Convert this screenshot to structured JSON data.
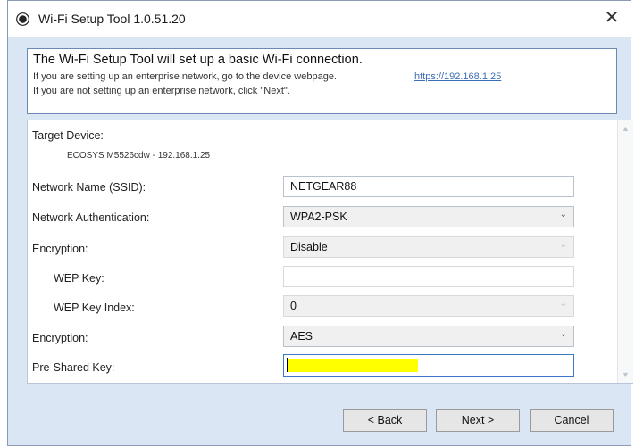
{
  "window": {
    "title": "Wi-Fi Setup Tool 1.0.51.20",
    "close_glyph": "✕"
  },
  "info": {
    "heading": "The Wi-Fi Setup Tool will set up a basic Wi-Fi connection.",
    "line1": "If you are setting up an enterprise network, go to the device webpage.",
    "link": "https://192.168.1.25",
    "line2": "If you are not setting up an enterprise network, click \"Next\"."
  },
  "form": {
    "target_device_label": "Target Device:",
    "target_device_value": "ECOSYS M5526cdw - 192.168.1.25",
    "ssid_label": "Network Name (SSID):",
    "ssid_value": "NETGEAR88",
    "auth_label": "Network Authentication:",
    "auth_value": "WPA2-PSK",
    "encryption1_label": "Encryption:",
    "encryption1_value": "Disable",
    "wep_key_label": "WEP Key:",
    "wep_key_value": "",
    "wep_index_label": "WEP Key Index:",
    "wep_index_value": "0",
    "encryption2_label": "Encryption:",
    "encryption2_value": "AES",
    "psk_label": "Pre-Shared Key:",
    "psk_value": ""
  },
  "buttons": {
    "back": "< Back",
    "next": "Next >",
    "cancel": "Cancel"
  },
  "icons": {
    "app": "app-logo-icon",
    "dropdown": "chevron-down-icon",
    "close": "close-icon"
  },
  "colors": {
    "link": "#3b6fb4",
    "highlight": "#ffff00",
    "dialog_bg": "#dbe6f4"
  }
}
